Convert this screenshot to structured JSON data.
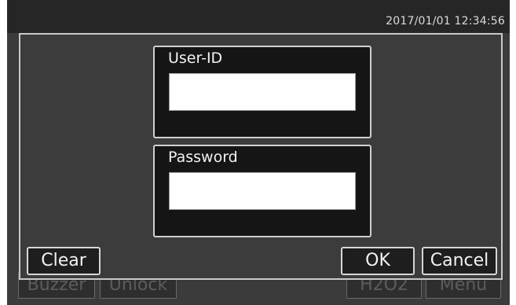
{
  "status_bar": {
    "datetime": "2017/01/01  12:34:56"
  },
  "login_dialog": {
    "user_id": {
      "label": "User-ID",
      "value": ""
    },
    "password": {
      "label": "Password",
      "value": ""
    },
    "buttons": {
      "clear": "Clear",
      "ok": "OK",
      "cancel": "Cancel"
    }
  },
  "background_buttons": {
    "buzzer": "Buzzer",
    "unlock": "Unlock",
    "h2o2": "H2O2",
    "menu": "Menu"
  }
}
